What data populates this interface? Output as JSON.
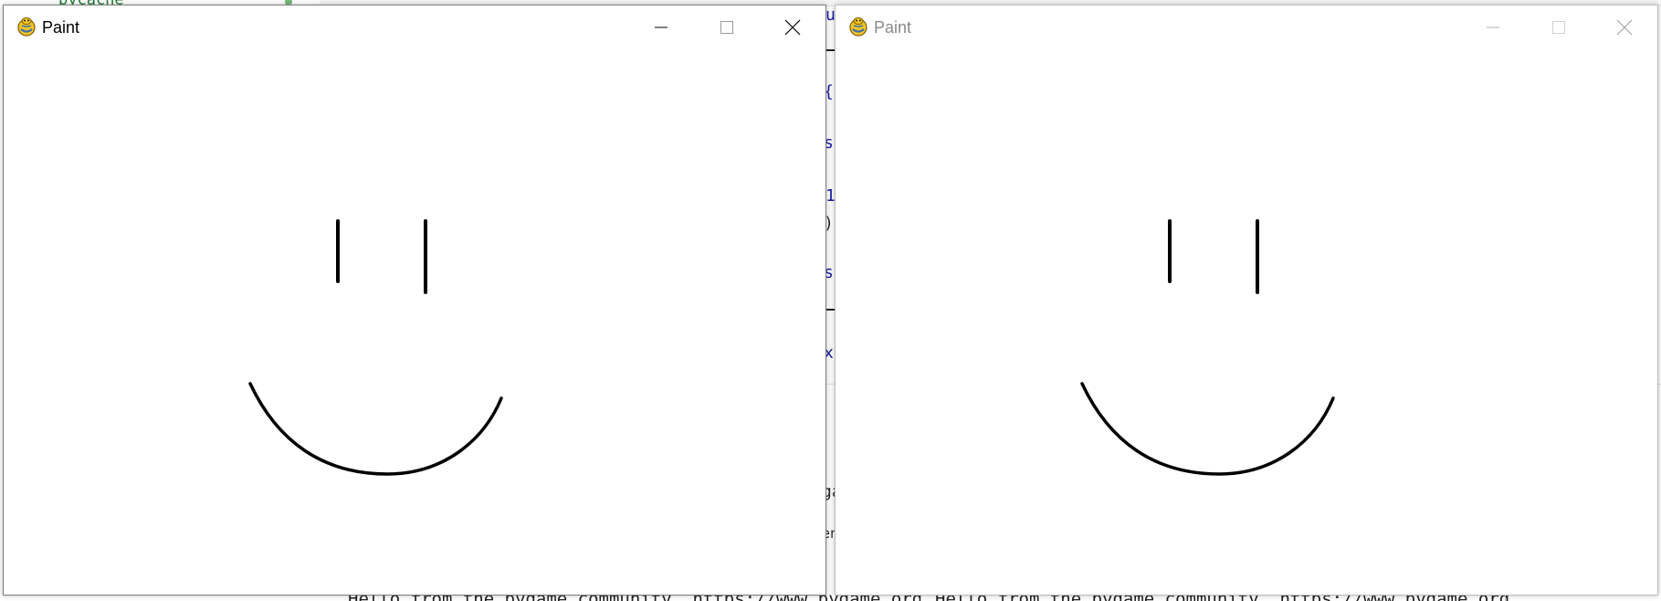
{
  "background": {
    "tree_item": "pycache",
    "code_fragments": [
      "u",
      "{",
      "s",
      "1",
      ")",
      "s",
      "x",
      "ga",
      "en"
    ],
    "console": {
      "left": "Hello from the pygame community. https://www.pygame.org",
      "right": "Hello from the pygame community. https://www.pygame.org"
    }
  },
  "windows": [
    {
      "title": "Paint",
      "state": "active",
      "icon": "pygame-snake-icon",
      "controls": [
        "minimize-icon",
        "maximize-icon",
        "close-icon"
      ]
    },
    {
      "title": "Paint",
      "state": "inactive",
      "icon": "pygame-snake-icon",
      "controls": [
        "minimize-icon",
        "maximize-icon",
        "close-icon"
      ]
    }
  ],
  "colors": {
    "stroke": "#000000",
    "code_blue": "#1a1aa6",
    "tree_green": "#1e7b2f"
  }
}
